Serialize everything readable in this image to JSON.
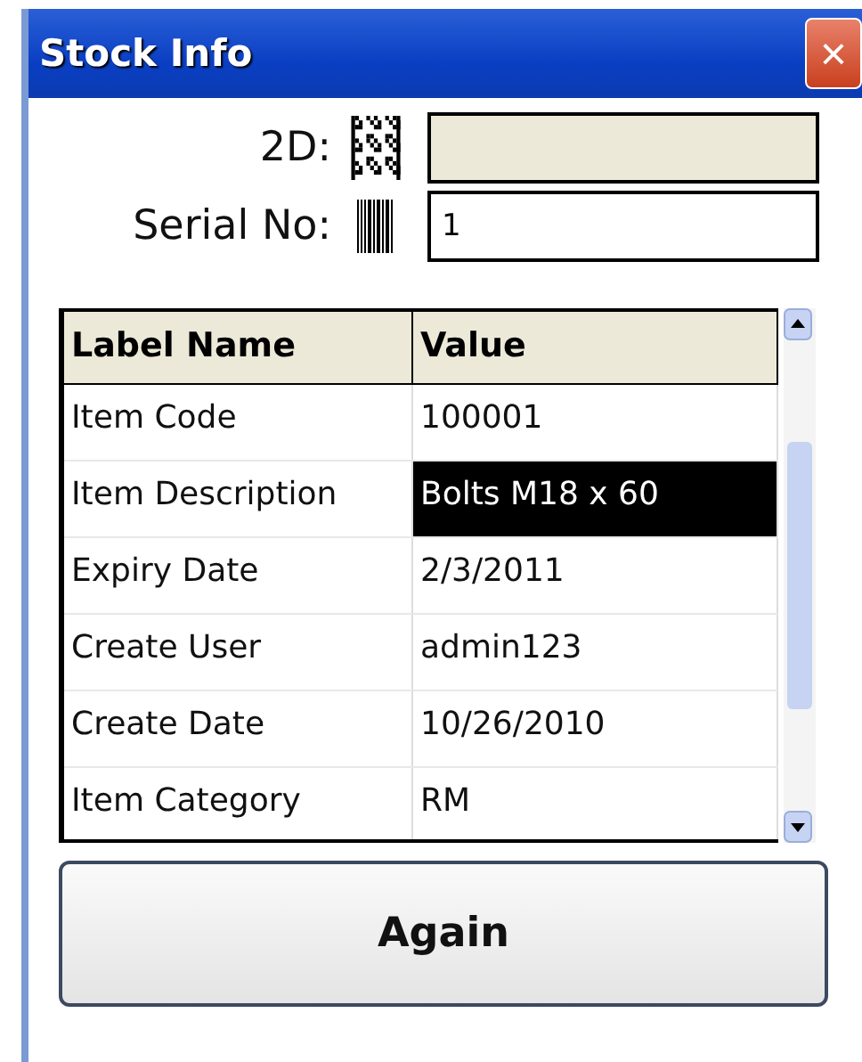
{
  "window": {
    "title": "Stock Info",
    "close": "×"
  },
  "fields": [
    {
      "kind": "matrix",
      "label": "2D:",
      "disabled": true
    },
    {
      "kind": "barcode",
      "label": "Serial No:",
      "value": "1",
      "disabled": false
    }
  ],
  "table": {
    "columns": [
      "Label Name",
      "Value"
    ],
    "rows": [
      {
        "label": "Item Code",
        "value": "100001",
        "selected": false
      },
      {
        "label": "Item Description",
        "value": "Bolts M18 x 60",
        "selected": true
      },
      {
        "label": "Expiry Date",
        "value": "2/3/2011",
        "selected": false
      },
      {
        "label": "Create User",
        "value": "admin123",
        "selected": false
      },
      {
        "label": "Create Date",
        "value": "10/26/2010",
        "selected": false
      },
      {
        "label": "Item Category",
        "value": "RM",
        "selected": false
      }
    ]
  },
  "buttons": [
    "Again"
  ]
}
